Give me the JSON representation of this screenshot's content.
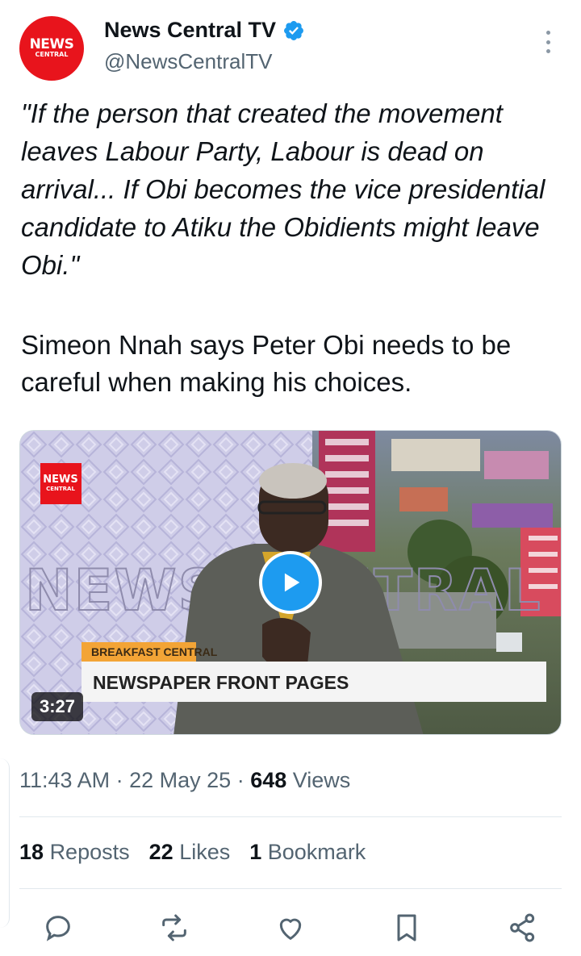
{
  "account": {
    "name": "News Central TV",
    "handle": "@NewsCentralTV",
    "avatar_line1": "NEWS",
    "avatar_line2": "CENTRAL"
  },
  "tweet": {
    "quote": "\"If the person that created the movement leaves Labour Party, Labour is dead on arrival... If Obi becomes the vice presidential candidate to Atiku the Obidients might leave Obi.\"",
    "body": "Simeon Nnah says Peter Obi needs to be careful when making his choices."
  },
  "video": {
    "duration": "3:27",
    "logo_line1": "NEWS",
    "logo_line2": "CENTRAL",
    "background_text": "NEWS CENTRAL",
    "lower_third_tag": "BREAKFAST CENTRAL",
    "lower_third_title": "NEWSPAPER FRONT PAGES"
  },
  "meta": {
    "time": "11:43 AM",
    "date": "22 May 25",
    "views_count": "648",
    "views_label": "Views"
  },
  "stats": {
    "reposts_count": "18",
    "reposts_label": "Reposts",
    "likes_count": "22",
    "likes_label": "Likes",
    "bookmarks_count": "1",
    "bookmarks_label": "Bookmark"
  },
  "colors": {
    "brand_red": "#e8141c",
    "accent_blue": "#1d9bf0",
    "secondary_text": "#536471"
  }
}
